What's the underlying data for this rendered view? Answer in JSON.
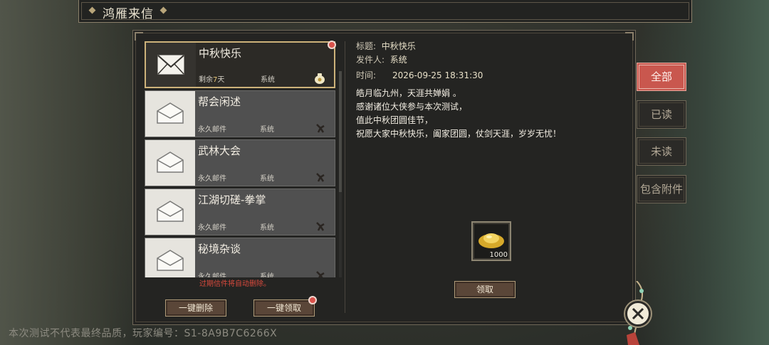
{
  "window": {
    "title": "鸿雁来信"
  },
  "mail_list": {
    "items": [
      {
        "title": "中秋快乐",
        "duration": "剩余",
        "days_num": "7",
        "days_unit": "天",
        "sender": "系统",
        "active": true,
        "unread": true,
        "attachment_icon": "money-bag-icon"
      },
      {
        "title": "帮会闲述",
        "duration": "永久邮件",
        "sender": "系统",
        "active": false,
        "unread": false,
        "attachment_icon": "empty-bag-icon"
      },
      {
        "title": "武林大会",
        "duration": "永久邮件",
        "sender": "系统",
        "active": false,
        "unread": false,
        "attachment_icon": "empty-bag-icon"
      },
      {
        "title": "江湖切磋-拳掌",
        "duration": "永久邮件",
        "sender": "系统",
        "active": false,
        "unread": false,
        "attachment_icon": "empty-bag-icon"
      },
      {
        "title": "秘境杂谈",
        "duration": "永久邮件",
        "sender": "系统",
        "active": false,
        "unread": false,
        "attachment_icon": "empty-bag-icon"
      }
    ],
    "expire_note": "过期信件将自动删除。",
    "delete_all_label": "一键删除",
    "claim_all_label": "一键领取"
  },
  "detail": {
    "subject_label": "标题:",
    "subject": "中秋快乐",
    "sender_label": "发件人:",
    "sender": "系统",
    "time_label": "时间:",
    "time": "2026-09-25 18:31:30",
    "body": [
      "皓月临九州，天涯共婵娟 。",
      "感谢诸位大侠参与本次测试，",
      "值此中秋团圆佳节，",
      "祝愿大家中秋快乐，阖家团圆，仗剑天涯，岁岁无忧！"
    ],
    "attachment": {
      "icon": "gold-ingot-icon",
      "count": "1000"
    },
    "claim_label": "领取"
  },
  "tabs": [
    {
      "label": "全部",
      "active": true
    },
    {
      "label": "已读",
      "active": false
    },
    {
      "label": "未读",
      "active": false
    },
    {
      "label": "包含附件",
      "active": false
    }
  ],
  "watermark": "本次测试不代表最终品质，玩家编号：S1-8A9B7C6266X",
  "colors": {
    "accent": "#c9574e",
    "gold": "#cdb27a",
    "alert": "#d94a3d"
  }
}
